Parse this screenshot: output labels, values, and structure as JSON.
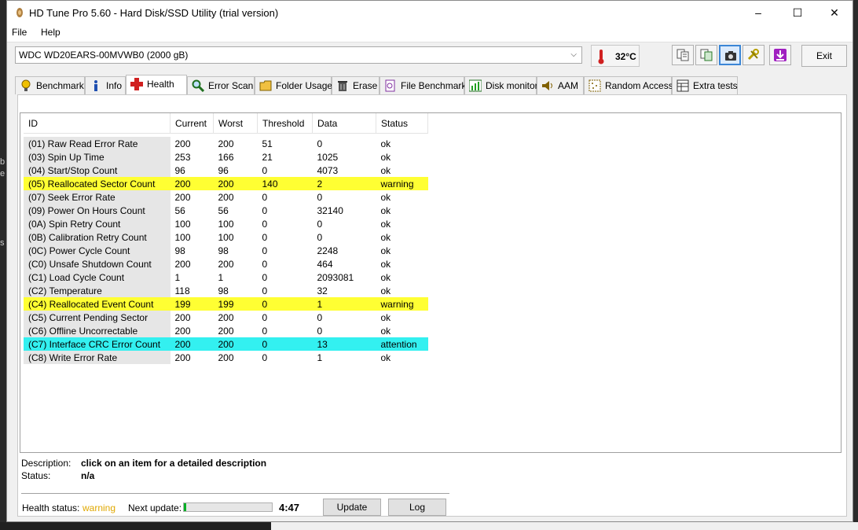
{
  "window": {
    "title": "HD Tune Pro 5.60 - Hard Disk/SSD Utility (trial version)",
    "minimize": "–",
    "maximize": "☐",
    "close": "✕"
  },
  "menu": {
    "file": "File",
    "help": "Help"
  },
  "toolbar": {
    "drive": "WDC WD20EARS-00MVWB0 (2000 gB)",
    "temperature": "32°C",
    "exit": "Exit"
  },
  "tabs": [
    {
      "label": "Benchmark",
      "icon": "lightbulb-icon"
    },
    {
      "label": "Info",
      "icon": "info-icon"
    },
    {
      "label": "Health",
      "icon": "health-cross-icon",
      "active": true
    },
    {
      "label": "Error Scan",
      "icon": "magnifier-icon"
    },
    {
      "label": "Folder Usage",
      "icon": "folder-icon"
    },
    {
      "label": "Erase",
      "icon": "trash-icon"
    },
    {
      "label": "File Benchmark",
      "icon": "file-benchmark-icon"
    },
    {
      "label": "Disk monitor",
      "icon": "monitor-chart-icon"
    },
    {
      "label": "AAM",
      "icon": "speaker-icon"
    },
    {
      "label": "Random Access",
      "icon": "random-access-icon"
    },
    {
      "label": "Extra tests",
      "icon": "extra-tests-icon"
    }
  ],
  "table": {
    "headers": [
      "ID",
      "Current",
      "Worst",
      "Threshold",
      "Data",
      "Status"
    ],
    "rows": [
      [
        "(01) Raw Read Error Rate",
        "200",
        "200",
        "51",
        "0",
        "ok"
      ],
      [
        "(03) Spin Up Time",
        "253",
        "166",
        "21",
        "1025",
        "ok"
      ],
      [
        "(04) Start/Stop Count",
        "96",
        "96",
        "0",
        "4073",
        "ok"
      ],
      [
        "(05) Reallocated Sector Count",
        "200",
        "200",
        "140",
        "2",
        "warning"
      ],
      [
        "(07) Seek Error Rate",
        "200",
        "200",
        "0",
        "0",
        "ok"
      ],
      [
        "(09) Power On Hours Count",
        "56",
        "56",
        "0",
        "32140",
        "ok"
      ],
      [
        "(0A) Spin Retry Count",
        "100",
        "100",
        "0",
        "0",
        "ok"
      ],
      [
        "(0B) Calibration Retry Count",
        "100",
        "100",
        "0",
        "0",
        "ok"
      ],
      [
        "(0C) Power Cycle Count",
        "98",
        "98",
        "0",
        "2248",
        "ok"
      ],
      [
        "(C0) Unsafe Shutdown Count",
        "200",
        "200",
        "0",
        "464",
        "ok"
      ],
      [
        "(C1) Load Cycle Count",
        "1",
        "1",
        "0",
        "2093081",
        "ok"
      ],
      [
        "(C2) Temperature",
        "118",
        "98",
        "0",
        "32",
        "ok"
      ],
      [
        "(C4) Reallocated Event Count",
        "199",
        "199",
        "0",
        "1",
        "warning"
      ],
      [
        "(C5) Current Pending Sector",
        "200",
        "200",
        "0",
        "0",
        "ok"
      ],
      [
        "(C6) Offline Uncorrectable",
        "200",
        "200",
        "0",
        "0",
        "ok"
      ],
      [
        "(C7) Interface CRC Error Count",
        "200",
        "200",
        "0",
        "13",
        "attention"
      ],
      [
        "(C8) Write Error Rate",
        "200",
        "200",
        "0",
        "1",
        "ok"
      ]
    ]
  },
  "details": {
    "description_label": "Description:",
    "description_value": "click on an item for a detailed description",
    "status_label": "Status:",
    "status_value": "n/a"
  },
  "footer": {
    "health_label": "Health status:",
    "health_value": "warning",
    "next_update_label": "Next update:",
    "next_update_progress": 0.03,
    "countdown": "4:47",
    "update_button": "Update",
    "log_button": "Log"
  },
  "colors": {
    "warning_row": "#ffff33",
    "attention_row": "#33f0f0",
    "health_warning_text": "#e0a800",
    "progress_fill": "#06b025"
  }
}
